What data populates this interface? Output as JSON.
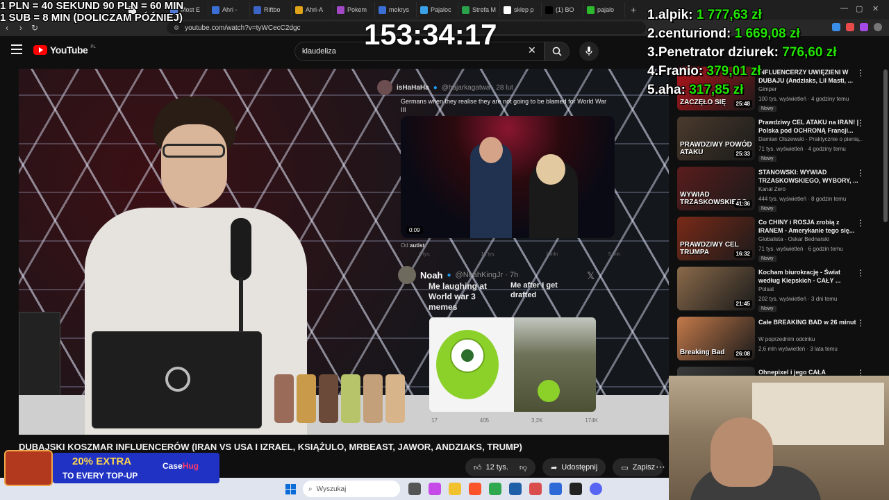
{
  "overlay": {
    "rules_line1": "1 PLN =  40 SEKUND 90 PLN = 60 MIN",
    "rules_line2": "1 SUB = 8 MIN (DOLICZAM PÓŹNIEJ)",
    "timer": "153:34:17",
    "leaderboard": [
      {
        "rank": "1.",
        "name": "alpik:",
        "amount": "1 777,63 zł"
      },
      {
        "rank": "2.",
        "name": "centuriond:",
        "amount": "1 669,08 zł"
      },
      {
        "rank": "3.",
        "name": "Penetrator dziurek:",
        "amount": "776,60 zł"
      },
      {
        "rank": "4.",
        "name": "Franio:",
        "amount": "379,01 zł"
      },
      {
        "rank": "5.",
        "name": "aha:",
        "amount": "317,85 zł"
      }
    ]
  },
  "browser": {
    "tabs": [
      {
        "label": "",
        "color": "#e8e8e8"
      },
      {
        "label": "Most E",
        "color": "#4f7bd6"
      },
      {
        "label": "Ahri -",
        "color": "#3b6fd6"
      },
      {
        "label": "Riftbo",
        "color": "#3c64c6"
      },
      {
        "label": "Ahri-A",
        "color": "#e0a41a"
      },
      {
        "label": "Pokem",
        "color": "#a349c7"
      },
      {
        "label": "mokrys",
        "color": "#3b6fd6"
      },
      {
        "label": "Pajaloc",
        "color": "#3aa0e8"
      },
      {
        "label": "Strefa M",
        "color": "#2aa14a"
      },
      {
        "label": "sklep p",
        "color": "#ffffff"
      },
      {
        "label": "(1) BO",
        "color": "#000000"
      },
      {
        "label": "pajalo",
        "color": "#2eb82e"
      }
    ],
    "url": "youtube.com/watch?v=tyWCecC2dgc"
  },
  "youtube": {
    "logo_text": "YouTube",
    "logo_cc": "PL",
    "search_value": "klaudeliza",
    "video_title": "DUBAJSKI KOSZMAR INFLUENCERÓW (IRAN VS USA I IZRAEL, KSIĄŻULO, MRBEAST, JAWOR, ANDZIAKS, TRUMP)",
    "actions": {
      "likes": "12 tys.",
      "share": "Udostępnij",
      "save": "Zapisz"
    }
  },
  "video_overlay": {
    "tweet1": {
      "name": "isHaHaHa",
      "handle": "@hajarkagatwa · 28 lut",
      "text": "Germans when they realise they are not going to be blamed for World War III",
      "duration": "0:09",
      "from_label": "Od",
      "from_name": "autist",
      "actions": [
        "1 tys.",
        "13 tys.",
        "1 mln",
        "5 mln"
      ]
    },
    "tweet2": {
      "name": "Noah",
      "handle": "@NoahKingJr · 7h",
      "left_caption": "Me laughing at World war 3 memes",
      "right_caption": "Me after I get drafted",
      "actions": [
        "17",
        "405",
        "3,2K",
        "174K"
      ]
    }
  },
  "recommendations": [
    {
      "title": "INFLUENCERZY UWIĘZIENI W DUBAJU (Andziaks, Lil Masti, ...",
      "channel": "Gimper",
      "meta": "100 tys. wyświetleń · 4 godziny temu",
      "badge": "Nowy",
      "duration": "25:48",
      "thumb_text": "ZACZĘŁO SIĘ",
      "thumb_color": "#b1141b"
    },
    {
      "title": "Prawdziwy CEL ATAKU na IRAN! | Polska pod OCHRONĄ Francji...",
      "channel": "Damian Olszewski - Praktycznie o pienią...",
      "meta": "71 tys. wyświetleń · 4 godziny temu",
      "badge": "Nowy",
      "duration": "25:33",
      "thumb_text": "PRAWDZIWY POWÓD ATAKU",
      "thumb_color": "#4a3a2c"
    },
    {
      "title": "STANOWSKI: WYWIAD TRZASKOWSKIEGO, WYBORY, ...",
      "channel": "Kanał Zero",
      "meta": "444 tys. wyświetleń · 8 godzin temu",
      "badge": "Nowy",
      "duration": "41:36",
      "thumb_text": "WYWIAD TRZASKOWSKIEGO",
      "thumb_color": "#5a1c1c"
    },
    {
      "title": "Co CHINY i ROSJA zrobią z IRANEM - Amerykanie tego się...",
      "channel": "Globalista - Oskar Bednarski",
      "meta": "71 tys. wyświetleń · 6 godzin temu",
      "badge": "Nowy",
      "duration": "16:32",
      "thumb_text": "PRAWDZIWY CEL TRUMPA",
      "thumb_color": "#7a2a18"
    },
    {
      "title": "Kocham biurokrację - Świat według Kiepskich - CAŁY ...",
      "channel": "Polsat",
      "meta": "202 tys. wyświetleń · 3 dni temu",
      "badge": "Nowy",
      "duration": "21:45",
      "thumb_text": "",
      "thumb_color": "#8a6a4a"
    },
    {
      "title": "Całe BREAKING BAD w 26 minut",
      "channel": "W poprzednim odcinku",
      "meta": "2,6 mln wyświetleń · 3 lata temu",
      "badge": "",
      "duration": "26:08",
      "thumb_text": "Breaking Bad",
      "thumb_color": "#c47a4a"
    },
    {
      "title": "Ohnepixel i jego CAŁA",
      "channel": "",
      "meta": "",
      "badge": "",
      "duration": "",
      "thumb_text": "",
      "thumb_color": "#3a3a3a"
    }
  ],
  "ad": {
    "extra": "20% EXTRA",
    "topup": "TO EVERY TOP-UP",
    "brand_a": "Case",
    "brand_b": "Hug"
  },
  "taskbar": {
    "search_placeholder": "Wyszukaj"
  },
  "colors": {
    "amount_green": "#23e600",
    "yt_red": "#ff0000"
  }
}
